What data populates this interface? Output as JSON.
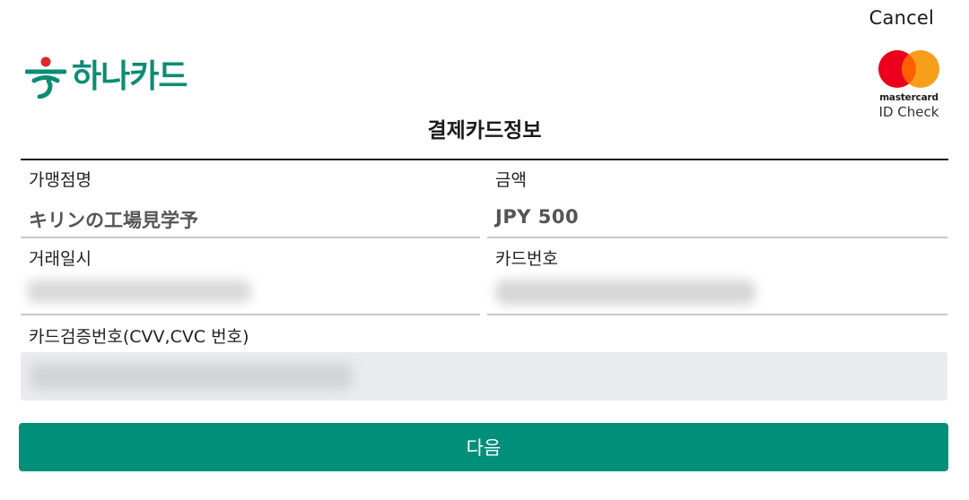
{
  "header": {
    "cancel_label": "Cancel",
    "logo_text": "하나카드",
    "mastercard_word": "mastercard",
    "mastercard_idcheck": "ID Check",
    "title": "결제카드정보"
  },
  "fields": {
    "merchant": {
      "label": "가맹점명",
      "value": "キリンの工場見学予"
    },
    "amount": {
      "label": "금액",
      "value": "JPY 500"
    },
    "datetime": {
      "label": "거래일시"
    },
    "card_number": {
      "label": "카드번호"
    },
    "cvc": {
      "label": "카드검증번호(CVV,CVC 번호)",
      "placeholder": ""
    }
  },
  "actions": {
    "next_label": "다음"
  },
  "colors": {
    "brand_green": "#0d8c75",
    "button_green": "#00907a",
    "hana_red": "#e0282e",
    "mc_red": "#eb001b",
    "mc_orange": "#f79e1b"
  },
  "icons": [
    "hana-card-logo-icon",
    "mastercard-logo-icon"
  ]
}
